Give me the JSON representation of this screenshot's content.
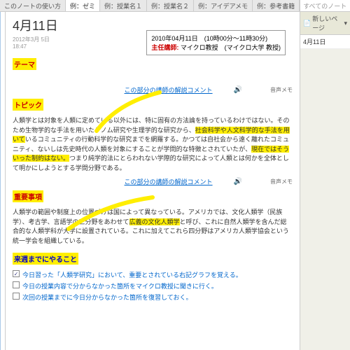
{
  "tabs": [
    {
      "label": "このノートの使い方"
    },
    {
      "label": "例：ゼミ",
      "active": true
    },
    {
      "label": "例：授業名１"
    },
    {
      "label": "例：授業名２"
    },
    {
      "label": "例：アイデアメモ"
    },
    {
      "label": "例：参考書籍"
    }
  ],
  "search": {
    "placeholder": "すべてのノートブックの検索 (Ctrl+E)"
  },
  "page": {
    "title": "4月11日",
    "date": "2012年3月 5日",
    "time": "18:47"
  },
  "infobox": {
    "line1": "2010年04月11日　(10時00分～11時30分)",
    "role": "主任講師:",
    "lecturer": "マイクロ教授　(マイクロ大学 教授)"
  },
  "sections": {
    "theme": "テーマ",
    "topic": "トピック",
    "important": "重要事項",
    "todo": "来週までにやること"
  },
  "comment_link": "この部分の講師の解説コメント",
  "audio": "音声メモ",
  "topic_text_parts": {
    "p1": "人類学とは対象を人類に定めている以外には、特に固有の方法論を持っているわけではない。そのため生物学的な手法を用いたゲノム研究や生理学的な研究から、",
    "h1": "社会科学や人文科学的な手法を用いて",
    "p2": "いるコミュニティの行動科学的な研究までを網羅する。かつては自社会から遠く離れたコミュニティ、ないしは先史時代の人類を対象にすることが学問的な特徴とされていたが、",
    "h2": "現在ではそういった制約はない。",
    "p3": "つまり純学的法にとらわれない学際的な研究によって人類とは何かを全体として明かにしようとする学問分野である。"
  },
  "important_text_parts": {
    "p1": "人類学の範囲や制度上の位置づけは国によって異なっている。アメリカでは、文化人類学（民族学）、考古学、言語学の三分野をあわせて",
    "h1": "広義の文化人類学",
    "p2": "と呼び、これに自然人類学を含んだ総合的な人類学科が大学に設置されている。これに加えてこれら四分野はアメリカ人類学協会という統一学会を組織している。"
  },
  "checklist": [
    {
      "checked": true,
      "text": "今日習った「人類学研究」において、重要とされている右記グラフを覚える。"
    },
    {
      "checked": false,
      "text": "今日の授業内容で分からなかった箇所をマイクロ教授に聞きに行く。"
    },
    {
      "checked": false,
      "text": "次回の授業までに今日分からなかった箇所を復習しておく。"
    }
  ],
  "sidebar": {
    "new_page": "新しいページ",
    "pages": [
      "4月11日"
    ]
  }
}
